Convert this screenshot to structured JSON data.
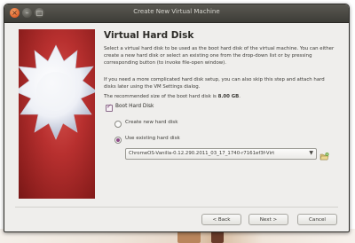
{
  "window": {
    "title": "Create New Virtual Machine",
    "close_glyph": "×",
    "minimize_glyph": "–",
    "maximize_glyph": "□"
  },
  "heading": "Virtual Hard Disk",
  "paragraph1": "Select a virtual hard disk to be used as the boot hard disk of the virtual machine. You can either create a new hard disk or select an existing one from the drop-down list or by pressing corresponding button (to invoke file-open window).",
  "paragraph2": "If you need a more complicated hard disk setup, you can also skip this step and attach hard disks later using the VM Settings dialog.",
  "recommended": {
    "prefix": "The recommended size of the boot hard disk is ",
    "size": "8.00 GB",
    "suffix": "."
  },
  "boot_hard_disk": {
    "label": "Boot Hard Disk",
    "checked": true
  },
  "options": {
    "create_new": {
      "label": "Create new hard disk",
      "selected": false
    },
    "use_existing": {
      "label": "Use existing hard disk",
      "selected": true
    }
  },
  "disk_combo": {
    "value": "ChromeOS-Vanilla-0.12.290.2011_03_17_1740-r7161ef3f-Virt",
    "arrow_glyph": "▼"
  },
  "buttons": {
    "back": "< Back",
    "next": "Next >",
    "cancel": "Cancel"
  },
  "icons": {
    "wizard_image": "starburst-icon",
    "folder_button": "open-folder-icon"
  },
  "colors": {
    "accent": "#8d4a86",
    "titlebar": "#3d3c37",
    "wizard_bg": "#b8302f"
  }
}
